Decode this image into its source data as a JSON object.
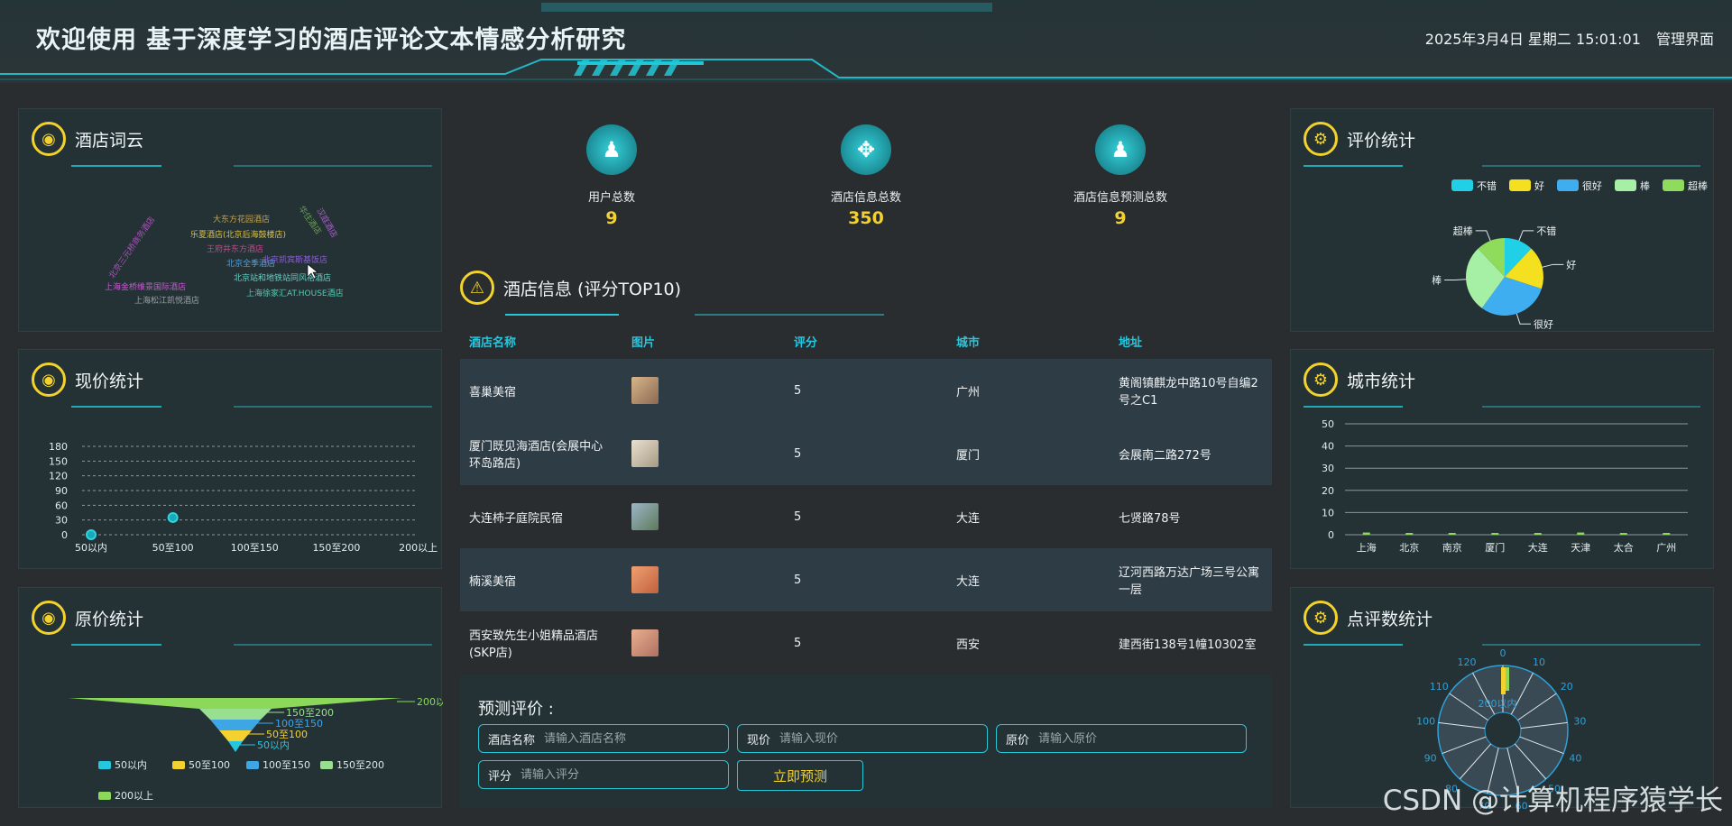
{
  "header": {
    "title": "欢迎使用 基于深度学习的酒店评论文本情感分析研究",
    "datetime": "2025年3月4日 星期二 15:01:01",
    "admin_link": "管理界面"
  },
  "panels": {
    "wordcloud": "酒店词云",
    "current_price": "现价统计",
    "original_price": "原价统计",
    "rating": "评价统计",
    "city": "城市统计",
    "review_count": "点评数统计",
    "hotel_info": "酒店信息 (评分TOP10)"
  },
  "wordcloud_words": [
    {
      "text": "大东方花园酒店",
      "color": "#c4a24d"
    },
    {
      "text": "乐夏酒店(北京后海鼓楼店)",
      "color": "#d9c24d"
    },
    {
      "text": "王府井东方酒店",
      "color": "#c04b8b"
    },
    {
      "text": "北京全季酒店",
      "color": "#5a9fd6"
    },
    {
      "text": "北京凯宾斯基饭店",
      "color": "#8a5fd0"
    },
    {
      "text": "北京站和地铁站同风格酒店",
      "color": "#6ad0c6"
    },
    {
      "text": "上海金桥维景国际酒店",
      "color": "#c45bd0"
    },
    {
      "text": "上海松江凯悦酒店",
      "color": "#9aa0a3"
    },
    {
      "text": "上海徐家汇AT.HOUSE酒店",
      "color": "#57c9b2"
    },
    {
      "text": "北京三元桥商务酒店",
      "color": "#b04fbf"
    },
    {
      "text": "华住酒店",
      "color": "#6a9f52"
    },
    {
      "text": "汉庭酒店",
      "color": "#b05bd0"
    }
  ],
  "stats": [
    {
      "label": "用户总数",
      "value": "9",
      "icon": "user-add-icon"
    },
    {
      "label": "酒店信息总数",
      "value": "350",
      "icon": "dna-icon"
    },
    {
      "label": "酒店信息预测总数",
      "value": "9",
      "icon": "user-icon"
    }
  ],
  "hotel_table": {
    "headers": [
      "酒店名称",
      "图片",
      "评分",
      "城市",
      "地址"
    ],
    "rows": [
      {
        "name": "喜巢美宿",
        "score": "5",
        "city": "广州",
        "address": "黄阁镇麒龙中路10号自编2号之C1"
      },
      {
        "name": "厦门既见海酒店(会展中心环岛路店)",
        "score": "5",
        "city": "厦门",
        "address": "会展南二路272号"
      },
      {
        "name": "大连柿子庭院民宿",
        "score": "5",
        "city": "大连",
        "address": "七贤路78号"
      },
      {
        "name": "楠溪美宿",
        "score": "5",
        "city": "大连",
        "address": "辽河西路万达广场三号公寓一层"
      },
      {
        "name": "西安致先生小姐精品酒店(SKP店)",
        "score": "5",
        "city": "西安",
        "address": "建西街138号1幢10302室"
      }
    ]
  },
  "predict": {
    "title": "预测评价 :",
    "fields": [
      {
        "label": "酒店名称",
        "placeholder": "请输入酒店名称"
      },
      {
        "label": "现价",
        "placeholder": "请输入现价"
      },
      {
        "label": "原价",
        "placeholder": "请输入原价"
      },
      {
        "label": "评分",
        "placeholder": "请输入评分"
      }
    ],
    "button": "立即预测"
  },
  "watermark": "CSDN @计算机程序猿学长",
  "chart_data": [
    {
      "type": "scatter",
      "panel": "现价统计",
      "categories": [
        "50以内",
        "50至100",
        "100至150",
        "150至200",
        "200以上"
      ],
      "values": [
        0,
        35,
        0,
        0,
        0
      ],
      "yticks": [
        0,
        30,
        60,
        90,
        120,
        150,
        180
      ],
      "ylim": [
        0,
        180
      ],
      "grid": true
    },
    {
      "type": "funnel",
      "panel": "原价统计",
      "categories": [
        "200以上",
        "150至200",
        "100至150",
        "50至100",
        "50以内"
      ],
      "legend": [
        "50以内",
        "50至100",
        "100至150",
        "150至200",
        "200以上"
      ],
      "colors": [
        "#24c7de",
        "#f3d12f",
        "#3fa6e6",
        "#98e08f",
        "#8bd85a"
      ]
    },
    {
      "type": "pie",
      "panel": "评价统计",
      "legend": [
        "不错",
        "好",
        "很好",
        "棒",
        "超棒"
      ],
      "categories": [
        "不错",
        "好",
        "很好",
        "棒",
        "超棒"
      ],
      "values": [
        12,
        18,
        30,
        28,
        12
      ],
      "colors": [
        "#1fd0e6",
        "#f5e020",
        "#3faef0",
        "#a6f0a6",
        "#8fdb5c"
      ],
      "legend_position": "top-right"
    },
    {
      "type": "bar",
      "panel": "城市统计",
      "categories": [
        "上海",
        "北京",
        "南京",
        "厦门",
        "大连",
        "天津",
        "太合",
        "广州"
      ],
      "values": [
        1,
        0,
        0,
        0,
        0,
        1,
        0,
        0
      ],
      "yticks": [
        0,
        10,
        20,
        30,
        40,
        50
      ],
      "ylim": [
        0,
        50
      ],
      "grid": true
    },
    {
      "type": "polar",
      "panel": "点评数统计",
      "angle_ticks": [
        "0",
        "10",
        "20",
        "30",
        "40",
        "50",
        "60",
        "70",
        "80",
        "90",
        "100",
        "110",
        "120"
      ],
      "center_label": "200以内"
    }
  ]
}
